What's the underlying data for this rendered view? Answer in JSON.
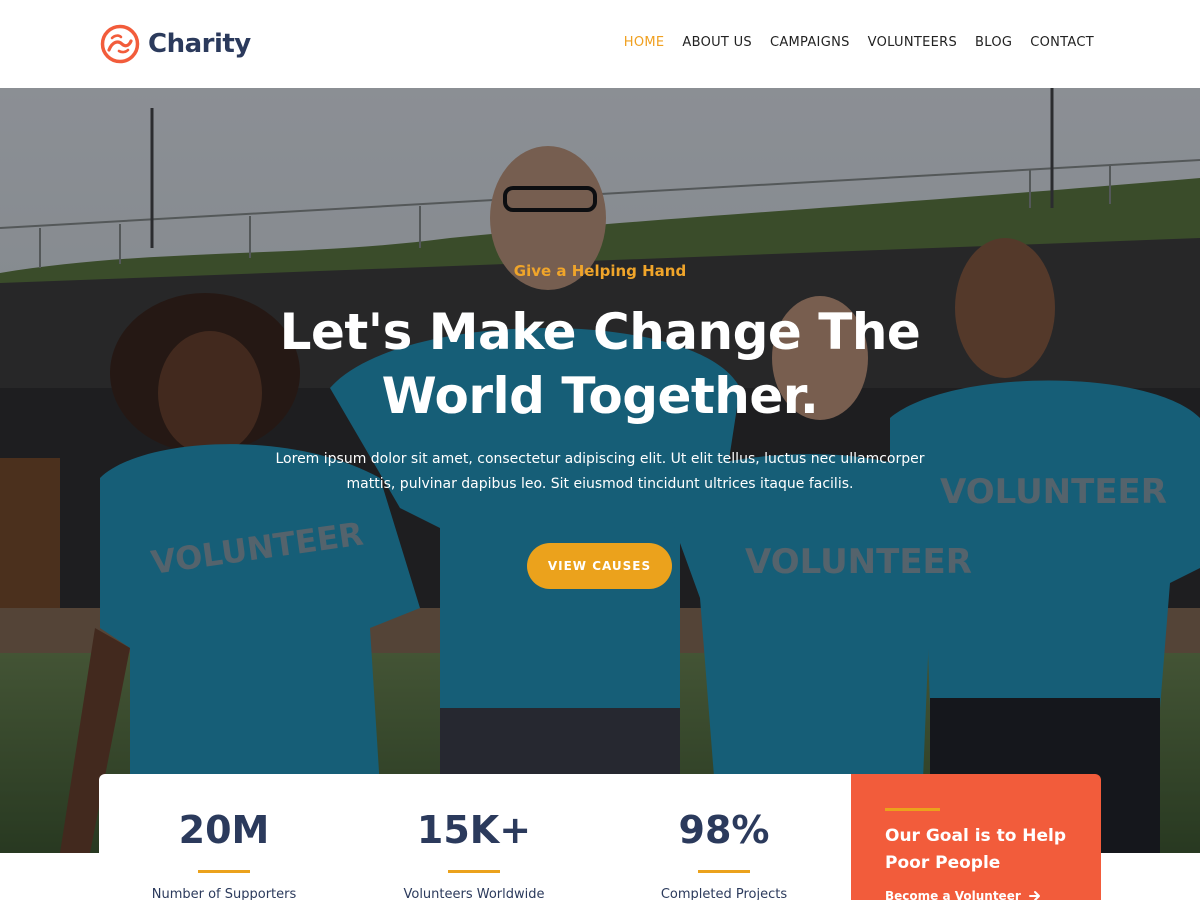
{
  "brand": {
    "name": "Charity",
    "logo_icon": "charity-hands-icon",
    "accent_color": "#f25c3b"
  },
  "nav": {
    "items": [
      {
        "label": "HOME",
        "active": true
      },
      {
        "label": "ABOUT US",
        "active": false
      },
      {
        "label": "CAMPAIGNS",
        "active": false
      },
      {
        "label": "VOLUNTEERS",
        "active": false
      },
      {
        "label": "BLOG",
        "active": false
      },
      {
        "label": "CONTACT",
        "active": false
      }
    ],
    "active_color": "#f0a020"
  },
  "hero": {
    "eyebrow": "Give a Helping Hand",
    "headline": "Let's Make Change The World Together.",
    "lead": "Lorem ipsum dolor sit amet, consectetur adipiscing elit. Ut elit tellus, luctus nec ullamcorper mattis, pulvinar dapibus leo. Sit eiusmod tincidunt ultrices itaque facilis.",
    "cta_label": "VIEW CAUSES",
    "cta_color": "#eba21c",
    "shirt_text": "VOLUNTEER"
  },
  "stats": [
    {
      "value": "20M",
      "label": "Number of Supporters"
    },
    {
      "value": "15K+",
      "label": "Volunteers Worldwide"
    },
    {
      "value": "98%",
      "label": "Completed Projects"
    }
  ],
  "goal": {
    "title": "Our Goal is to Help Poor People",
    "link_label": "Become a Volunteer",
    "link_icon": "arrow-right-icon"
  }
}
